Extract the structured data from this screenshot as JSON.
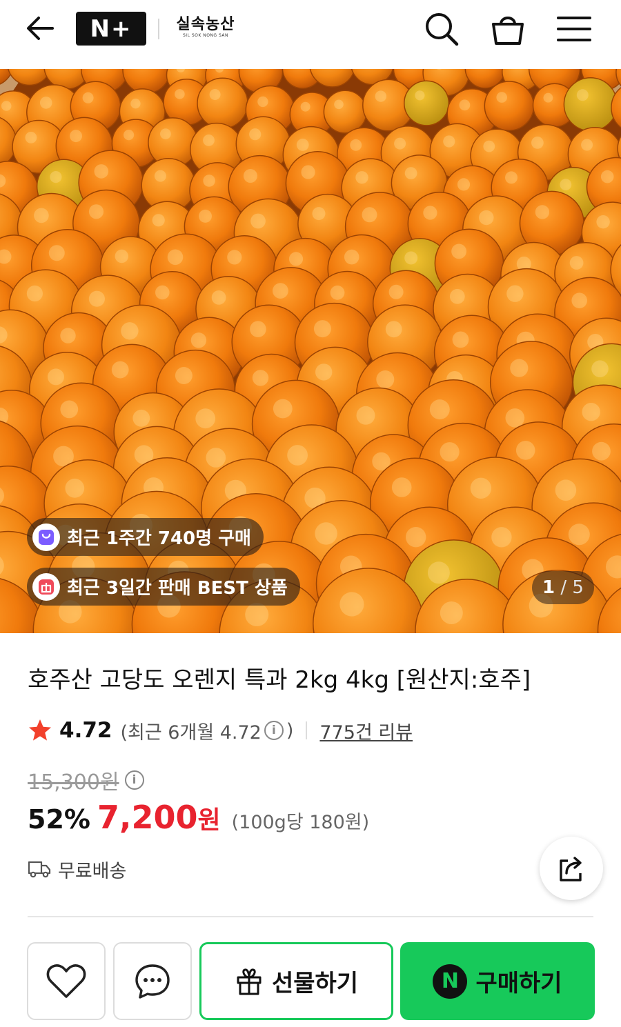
{
  "header": {
    "logo_text": "N+",
    "brand_name": "실속농산",
    "brand_sub": "SIL SOK NONG SAN",
    "icons": [
      "arrow-left-icon",
      "search-icon",
      "shopping-basket-icon",
      "menu-icon"
    ]
  },
  "gallery": {
    "badges": [
      {
        "text": "최근 1주간 740명 구매",
        "icon": "bag-icon",
        "icon_color": "#7b5cff"
      },
      {
        "text": "최근 3일간 판매 BEST 상품",
        "icon": "gift-icon",
        "icon_color": "#f04a5a"
      }
    ],
    "current_page": "1",
    "total_pages": "5"
  },
  "product": {
    "title": "호주산 고당도 오렌지 특과 2kg 4kg [원산지:호주]",
    "rating": "4.72",
    "recent_rating_prefix": "(최근 6개월 4.72",
    "recent_rating_suffix": ")",
    "review_count": "775건 리뷰",
    "original_price": "15,300원",
    "discount_rate": "52%",
    "sale_price": "7,200",
    "sale_unit": "원",
    "unit_price": "(100g당 180원)",
    "shipping": "무료배송"
  },
  "actions": {
    "gift_label": "선물하기",
    "buy_label": "구매하기",
    "npay_letter": "N"
  },
  "colors": {
    "accent_green": "#17c95a",
    "sale_red": "#e8232f",
    "star": "#f2402b"
  }
}
